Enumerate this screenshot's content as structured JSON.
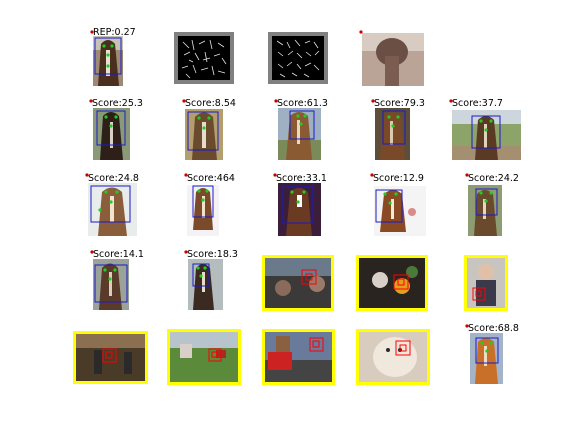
{
  "figure": {
    "header": {
      "rep_label": "REP:0.27"
    },
    "rows": [
      {
        "cells": [
          {
            "kind": "photo",
            "subject": "horse-head"
          },
          {
            "kind": "hog",
            "subject": "hog-feature-grid-a"
          },
          {
            "kind": "hog",
            "subject": "hog-feature-grid-b"
          },
          {
            "kind": "photo",
            "subject": "blurred-mean-horse"
          }
        ]
      },
      {
        "cells": [
          {
            "kind": "detection",
            "score_label": "Score:25.3",
            "outcome": "correct"
          },
          {
            "kind": "detection",
            "score_label": "Score:8.54",
            "outcome": "correct"
          },
          {
            "kind": "detection",
            "score_label": "Score:61.3",
            "outcome": "correct"
          },
          {
            "kind": "detection",
            "score_label": "Score:79.3",
            "outcome": "correct"
          },
          {
            "kind": "detection",
            "score_label": "Score:37.7",
            "outcome": "correct"
          }
        ]
      },
      {
        "cells": [
          {
            "kind": "detection",
            "score_label": "Score:24.8",
            "outcome": "correct"
          },
          {
            "kind": "detection",
            "score_label": "Score:464",
            "outcome": "correct"
          },
          {
            "kind": "detection",
            "score_label": "Score:33.1",
            "outcome": "correct"
          },
          {
            "kind": "detection",
            "score_label": "Score:12.9",
            "outcome": "correct"
          },
          {
            "kind": "detection",
            "score_label": "Score:24.2",
            "outcome": "correct"
          }
        ]
      },
      {
        "cells": [
          {
            "kind": "detection",
            "score_label": "Score:14.1",
            "outcome": "correct"
          },
          {
            "kind": "detection",
            "score_label": "Score:18.3",
            "outcome": "correct"
          },
          {
            "kind": "false-positive",
            "score_label": "",
            "outcome": "false-positive"
          },
          {
            "kind": "false-positive",
            "score_label": "",
            "outcome": "false-positive"
          },
          {
            "kind": "false-positive",
            "score_label": "",
            "outcome": "false-positive"
          }
        ]
      },
      {
        "cells": [
          {
            "kind": "false-positive",
            "score_label": "",
            "outcome": "false-positive"
          },
          {
            "kind": "false-positive",
            "score_label": "",
            "outcome": "false-positive"
          },
          {
            "kind": "false-positive",
            "score_label": "",
            "outcome": "false-positive"
          },
          {
            "kind": "false-positive",
            "score_label": "",
            "outcome": "false-positive"
          },
          {
            "kind": "detection",
            "score_label": "Score:68.8",
            "outcome": "correct"
          }
        ]
      }
    ],
    "colors": {
      "background": "#ffffff",
      "detection_box": "#1a1acc",
      "false_positive_frame": "#ffff00",
      "false_positive_box": "#ff0000",
      "part_keypoints": "#22cc22",
      "marker": "#cc0000"
    }
  }
}
